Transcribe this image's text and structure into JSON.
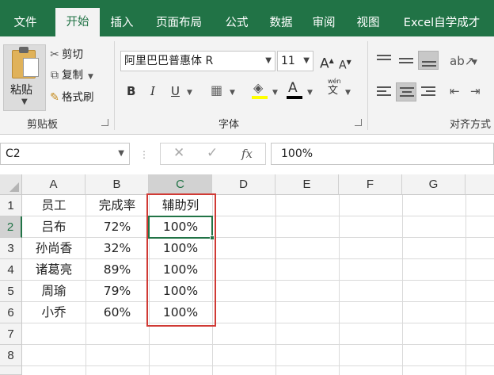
{
  "ribbon": {
    "tabs": [
      {
        "label": "文件",
        "active": false
      },
      {
        "label": "开始",
        "active": true
      },
      {
        "label": "插入",
        "active": false
      },
      {
        "label": "页面布局",
        "active": false
      },
      {
        "label": "公式",
        "active": false
      },
      {
        "label": "数据",
        "active": false
      },
      {
        "label": "审阅",
        "active": false
      },
      {
        "label": "视图",
        "active": false
      },
      {
        "label": "Excel自学成才",
        "active": false
      }
    ],
    "clipboard": {
      "paste_label": "粘贴",
      "cut_label": "剪切",
      "copy_label": "复制",
      "format_painter_label": "格式刷",
      "group_label": "剪贴板"
    },
    "font": {
      "font_name": "阿里巴巴普惠体 R",
      "font_size": "11",
      "grow_label": "A",
      "shrink_label": "A",
      "bold_label": "B",
      "italic_label": "I",
      "underline_label": "U",
      "font_color_label": "A",
      "phonetic_top": "wén",
      "phonetic_bottom": "文",
      "group_label": "字体",
      "highlight_color": "#ffff00",
      "font_color": "#000000"
    },
    "alignment": {
      "group_label": "对齐方式"
    }
  },
  "formula_bar": {
    "name_box": "C2",
    "cancel_symbol": "✕",
    "enter_symbol": "✓",
    "fx_label": "fx",
    "content": "100%"
  },
  "sheet": {
    "columns": [
      "A",
      "B",
      "C",
      "D",
      "E",
      "F",
      "G"
    ],
    "rows": [
      "1",
      "2",
      "3",
      "4",
      "5",
      "6",
      "7",
      "8"
    ],
    "selected_cell": "C2",
    "cells": [
      [
        "员工",
        "完成率",
        "辅助列"
      ],
      [
        "吕布",
        "72%",
        "100%"
      ],
      [
        "孙尚香",
        "32%",
        "100%"
      ],
      [
        "诸葛亮",
        "89%",
        "100%"
      ],
      [
        "周瑜",
        "79%",
        "100%"
      ],
      [
        "小乔",
        "60%",
        "100%"
      ]
    ]
  },
  "colors": {
    "accent": "#217346",
    "highlight_box": "#d03a35"
  }
}
